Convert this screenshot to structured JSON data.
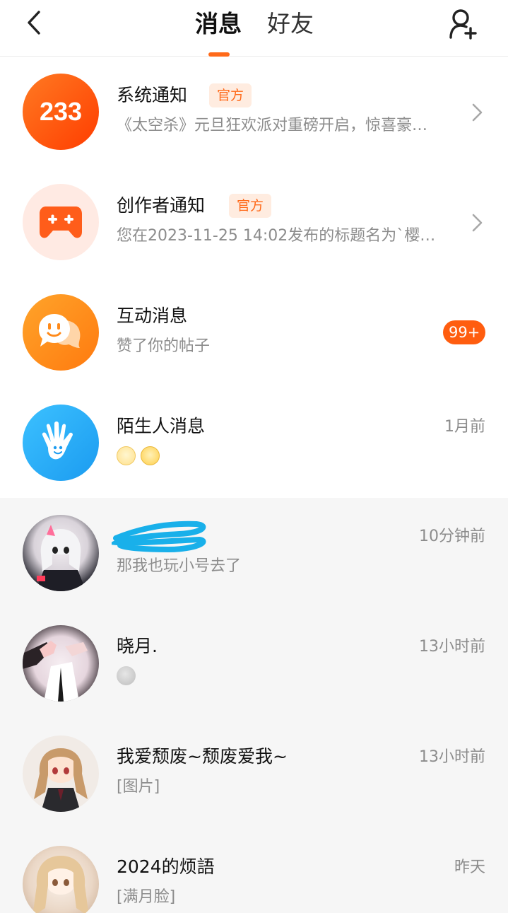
{
  "header": {
    "tab_messages": "消息",
    "tab_friends": "好友",
    "back_icon": "back-arrow-icon",
    "add_friend_icon": "add-friend-icon"
  },
  "colors": {
    "accent": "#ff6a1a",
    "badge_bg": "#ffece0",
    "muted": "#8c8c8c"
  },
  "system_rows": [
    {
      "title": "系统通知",
      "badge": "官方",
      "preview": "《太空杀》元旦狂欢派对重磅开启，惊喜豪…",
      "icon": "233-logo-icon"
    },
    {
      "title": "创作者通知",
      "badge": "官方",
      "preview": "您在2023-11-25 14:02发布的标题名为`樱…",
      "icon": "gamepad-plus-icon"
    },
    {
      "title": "互动消息",
      "preview": "赞了你的帖子",
      "count": "99+",
      "icon": "chat-smiley-icon"
    },
    {
      "title": "陌生人消息",
      "time": "1月前",
      "icon": "waving-hand-icon",
      "emojis": [
        "eye-roll-emoji",
        "sweat-smile-emoji"
      ]
    }
  ],
  "chats": [
    {
      "title": "",
      "preview": "那我也玩小号去了",
      "time": "10分钟前",
      "avatar": "anime-avatar-white-hair"
    },
    {
      "title": "晓月.",
      "preview": "",
      "time": "13小时前",
      "avatar": "anime-avatar-hands",
      "emojis": [
        "grey-smile-emoji"
      ]
    },
    {
      "title": "我爱颓废~颓废爱我~",
      "preview": "[图片]",
      "time": "13小时前",
      "avatar": "anime-avatar-twintails"
    },
    {
      "title": "2024的烦語",
      "preview": "[满月脸]",
      "time": "昨天",
      "avatar": "anime-avatar-blonde"
    }
  ]
}
